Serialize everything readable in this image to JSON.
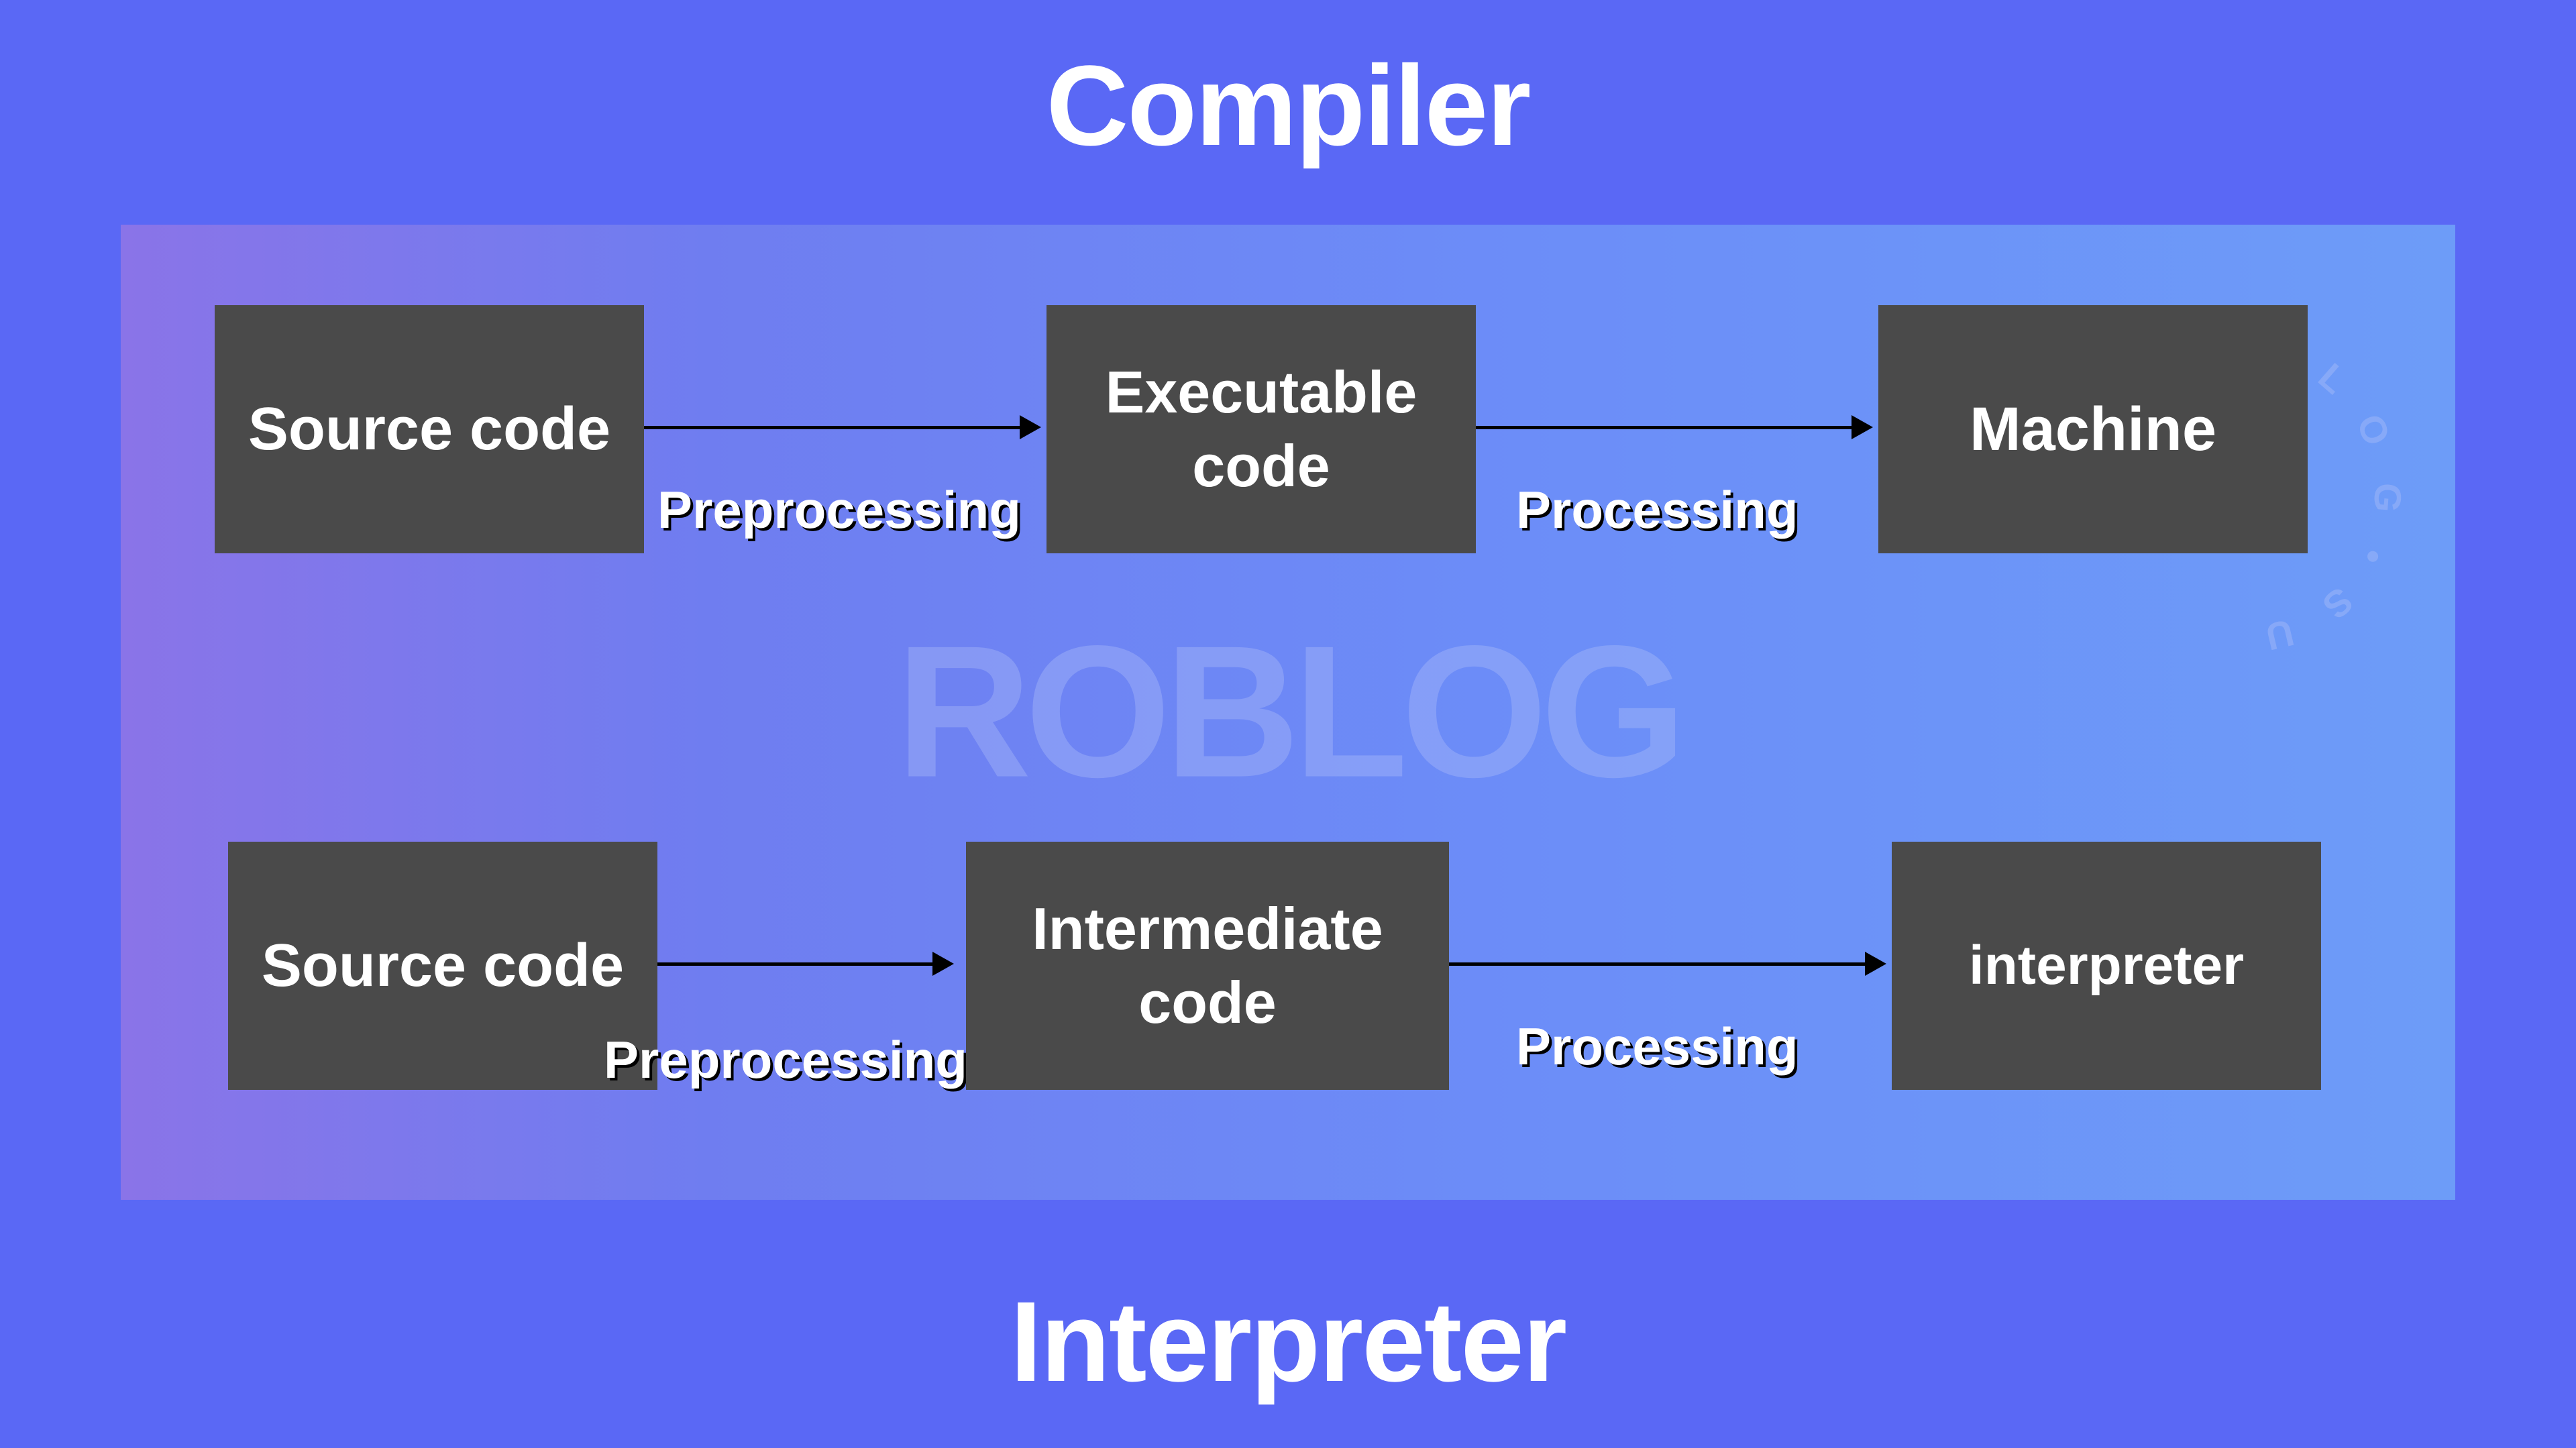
{
  "titles": {
    "top": "Compiler",
    "bottom": "Interpreter"
  },
  "watermark": "ROBLOG",
  "rows": {
    "compiler": {
      "box1": "Source code",
      "arrow1_label": "Preprocessing",
      "box2": "Executable code",
      "arrow2_label": "Processing",
      "box3": "Machine"
    },
    "interpreter": {
      "box1": "Source code",
      "arrow1_label": "Preprocessing",
      "box2": "Intermediate code",
      "arrow2_label": "Processing",
      "box3": "interpreter"
    }
  },
  "colors": {
    "outer_bg": "#5a68f5",
    "box_bg": "#4a4a4a",
    "text": "#ffffff",
    "arrow": "#000000"
  }
}
